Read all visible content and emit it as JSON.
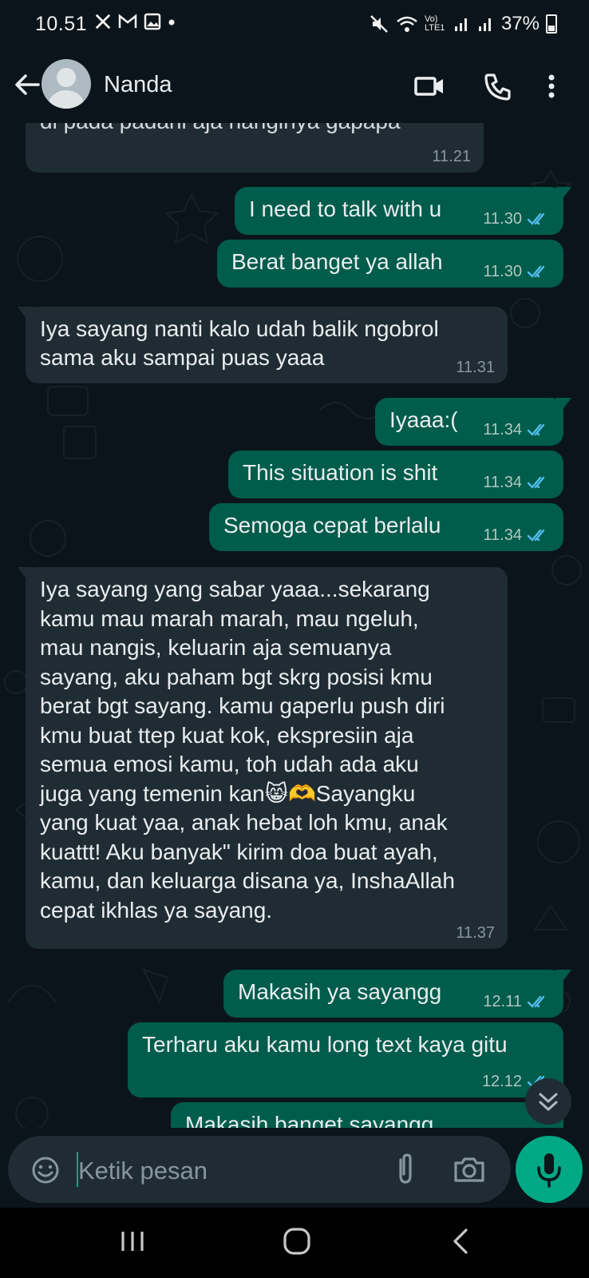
{
  "status_bar": {
    "time": "10.51",
    "left_icons": [
      "x-icon",
      "gmail-icon",
      "gallery-icon",
      "dot-icon"
    ],
    "network": "Vo) LTE1",
    "battery": "37%"
  },
  "header": {
    "contact_name": "Nanda"
  },
  "messages": [
    {
      "dir": "in",
      "text": "di pada padahi aja nanginya gapapa",
      "time": "11.21"
    },
    {
      "dir": "out",
      "text": "I need to talk with u",
      "time": "11.30",
      "status": "read"
    },
    {
      "dir": "out",
      "text": "Berat banget ya allah",
      "time": "11.30",
      "status": "read"
    },
    {
      "dir": "in",
      "text": "Iya sayang nanti kalo udah balik ngobrol\nsama aku sampai puas yaaa",
      "time": "11.31"
    },
    {
      "dir": "out",
      "text": "Iyaaa:(",
      "time": "11.34",
      "status": "read"
    },
    {
      "dir": "out",
      "text": "This situation is shit",
      "time": "11.34",
      "status": "read"
    },
    {
      "dir": "out",
      "text": "Semoga cepat berlalu",
      "time": "11.34",
      "status": "read"
    },
    {
      "dir": "in",
      "text": "Iya sayang yang sabar yaaa...sekarang\nkamu mau marah marah, mau ngeluh,\nmau nangis, keluarin aja semuanya\nsayang, aku paham bgt skrg posisi kmu\nberat bgt sayang. kamu gaperlu push diri\nkmu buat ttep kuat kok, ekspresiin aja\nsemua emosi kamu, toh udah ada aku\njuga yang temenin kan😸🫶Sayangku\nyang kuat yaa, anak hebat loh kmu, anak\nkuattt! Aku banyak\" kirim doa buat ayah,\nkamu, dan keluarga disana ya, InshaAllah\ncepat ikhlas ya sayang.",
      "time": "11.37"
    },
    {
      "dir": "out",
      "text": "Makasih ya sayangg",
      "time": "12.11",
      "status": "read"
    },
    {
      "dir": "out",
      "text": "Terharu aku kamu long text kaya gitu",
      "time": "12.12",
      "status": "read"
    },
    {
      "dir": "out",
      "text": "Makasih banget sayangg",
      "time": "",
      "status": "read"
    }
  ],
  "composer": {
    "placeholder": "Ketik pesan"
  },
  "colors": {
    "background": "#0b141a",
    "incoming_bubble": "#202c33",
    "outgoing_bubble": "#005c4b",
    "read_tick": "#53bdeb",
    "accent": "#00a884"
  }
}
